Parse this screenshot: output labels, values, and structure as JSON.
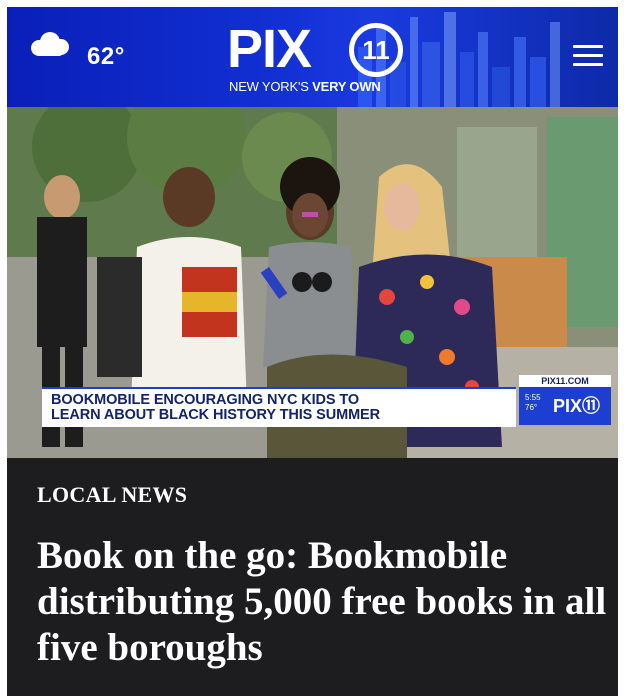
{
  "header": {
    "weather_icon": "cloud-icon",
    "temperature": "62°",
    "logo_text": "PIX",
    "logo_badge": "11",
    "tagline_regular": "NEW YORK'S ",
    "tagline_bold": "VERY OWN",
    "menu_icon": "hamburger-menu-icon",
    "brand_color": "#1230d4"
  },
  "hero": {
    "lower_third_line1": "BOOKMOBILE ENCOURAGING NYC KIDS TO",
    "lower_third_line2": "LEARN ABOUT BLACK HISTORY THIS SUMMER",
    "bug_site": "PIX11.COM",
    "bug_time": "5:55",
    "bug_temp": "76°",
    "bug_logo": "PIX⑪"
  },
  "article": {
    "section": "LOCAL NEWS",
    "headline": "Book on the go: Bookmobile distributing 5,000 free books in all five boroughs",
    "background_color": "#1d1d1f"
  }
}
